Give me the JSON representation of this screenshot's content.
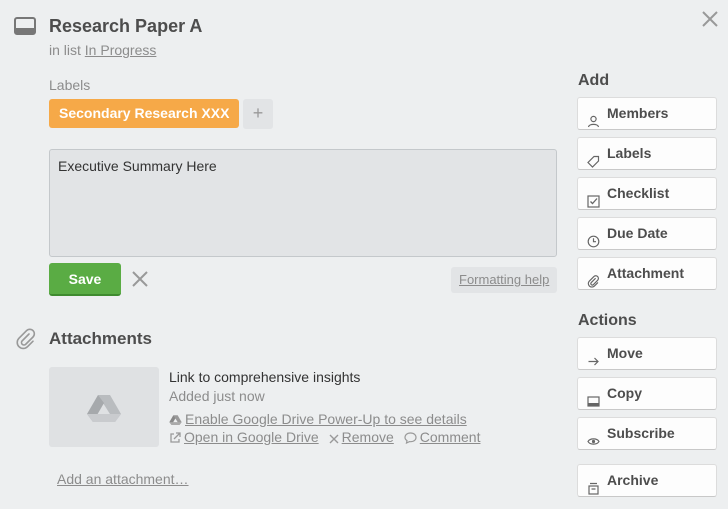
{
  "card": {
    "title": "Research Paper A",
    "in_list_prefix": "in list",
    "list_name": "In Progress"
  },
  "labels": {
    "heading": "Labels",
    "items": [
      {
        "text": "Secondary Research XXX",
        "color": "#f6a948"
      }
    ],
    "add_symbol": "+"
  },
  "description": {
    "value": "Executive Summary Here",
    "save_label": "Save",
    "formatting_help": "Formatting help"
  },
  "attachments": {
    "heading": "Attachments",
    "items": [
      {
        "name": "Link to comprehensive insights",
        "added": "Added just now",
        "powerup_link": "Enable Google Drive Power-Up to see details",
        "open_link": "Open in Google Drive",
        "remove_link": "Remove",
        "comment_link": "Comment",
        "thumbnail_icon": "google-drive-icon"
      }
    ],
    "add_link": "Add an attachment…"
  },
  "sidebar": {
    "add_heading": "Add",
    "add_buttons": [
      {
        "label": "Members",
        "icon": "person-icon"
      },
      {
        "label": "Labels",
        "icon": "tag-icon"
      },
      {
        "label": "Checklist",
        "icon": "checkbox-icon"
      },
      {
        "label": "Due Date",
        "icon": "clock-icon"
      },
      {
        "label": "Attachment",
        "icon": "paperclip-icon"
      }
    ],
    "actions_heading": "Actions",
    "action_buttons": [
      {
        "label": "Move",
        "icon": "arrow-right-icon"
      },
      {
        "label": "Copy",
        "icon": "card-icon"
      },
      {
        "label": "Subscribe",
        "icon": "eye-icon"
      },
      {
        "label": "Archive",
        "icon": "archive-icon"
      }
    ]
  },
  "colors": {
    "background": "#edeff0",
    "label_orange": "#f6a948",
    "save_green": "#5aac44",
    "muted_text": "#8c8c8c"
  }
}
